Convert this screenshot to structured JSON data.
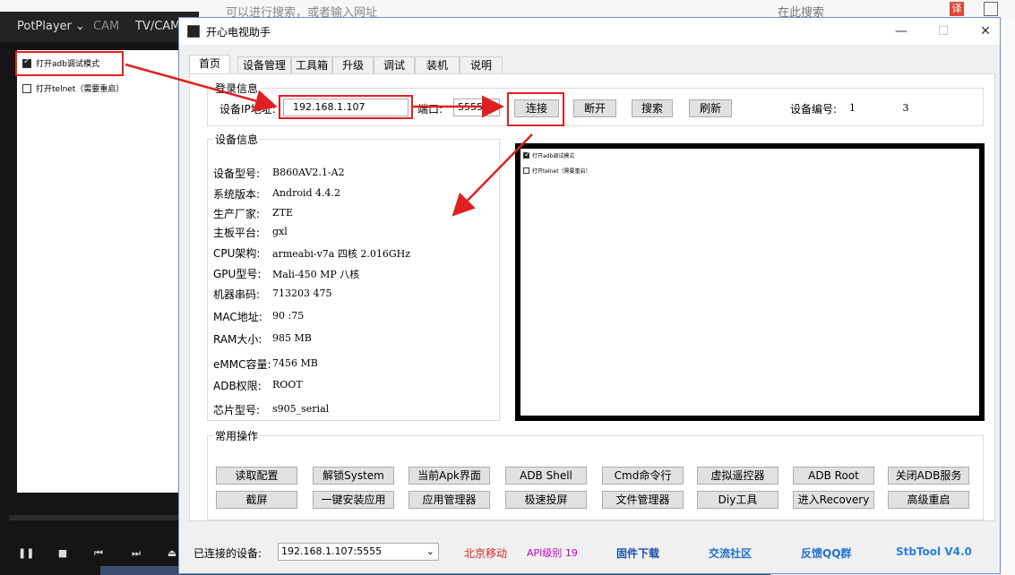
{
  "browser": {
    "address_text": "可以进行搜索，或者输入网址",
    "search_text": "在此搜索",
    "translate_label": "译"
  },
  "potplayer": {
    "tabs": [
      "PotPlayer",
      "CAM",
      "TV/CAM"
    ],
    "options": [
      {
        "label": "打开adb调试模式",
        "checked": true
      },
      {
        "label": "打开telnet（需要重启）",
        "checked": false
      }
    ]
  },
  "window": {
    "title": "开心电视助手",
    "tabs": [
      "首页",
      "设备管理",
      "工具箱",
      "升级",
      "调试",
      "装机",
      "说明"
    ],
    "login": {
      "title": "登录信息",
      "ip_label": "设备IP地址:",
      "ip_value": "192.168.1.107",
      "port_label": "端口:",
      "port_value": "5555",
      "buttons": [
        "连接",
        "断开",
        "搜索",
        "刷新"
      ],
      "device_no_label": "设备编号:",
      "device_no_value": "1               3"
    },
    "device_info": {
      "title": "设备信息",
      "rows": [
        {
          "label": "设备型号:",
          "value": "B860AV2.1-A2"
        },
        {
          "label": "系统版本:",
          "value": "Android 4.4.2"
        },
        {
          "label": "生产厂家:",
          "value": "ZTE"
        },
        {
          "label": "主板平台:",
          "value": "gxl"
        },
        {
          "label": "CPU架构:",
          "value": "armeabi-v7a 四核 2.016GHz"
        },
        {
          "label": "GPU型号:",
          "value": "Mali-450 MP 八核"
        },
        {
          "label": "机器串码:",
          "value": "713203         475"
        },
        {
          "label": "MAC地址:",
          "value": "90         :75"
        },
        {
          "label": "RAM大小:",
          "value": "985 MB"
        },
        {
          "label": "eMMC容量:",
          "value": "7456 MB"
        },
        {
          "label": "ADB权限:",
          "value": "ROOT"
        },
        {
          "label": "芯片型号:",
          "value": "s905_serial"
        }
      ]
    },
    "preview": {
      "options": [
        {
          "label": "打开adb调试模式",
          "checked": true
        },
        {
          "label": "打开telnet（需要重启）",
          "checked": false
        }
      ]
    },
    "ops": {
      "title": "常用操作",
      "row1": [
        "读取配置",
        "解锁System",
        "当前Apk界面",
        "ADB Shell",
        "Cmd命令行",
        "虚拟遥控器",
        "ADB  Root",
        "关闭ADB服务"
      ],
      "row2": [
        "截屏",
        "一键安装应用",
        "应用管理器",
        "极速投屏",
        "文件管理器",
        "Diy工具",
        "进入Recovery",
        "高级重启"
      ]
    },
    "status": {
      "connected_label": "已连接的设备:",
      "connected_value": "192.168.1.107:5555",
      "isp": "北京移动",
      "api": "API级别 19",
      "firmware": "固件下载",
      "community": "交流社区",
      "feedback": "反馈QQ群",
      "version": "StbTool V4.0"
    },
    "colors": {
      "highlight": "#e02020",
      "isp": "#e02020",
      "api": "#c000c0",
      "link": "#1f6fd0",
      "version": "#2a7ee0"
    }
  }
}
